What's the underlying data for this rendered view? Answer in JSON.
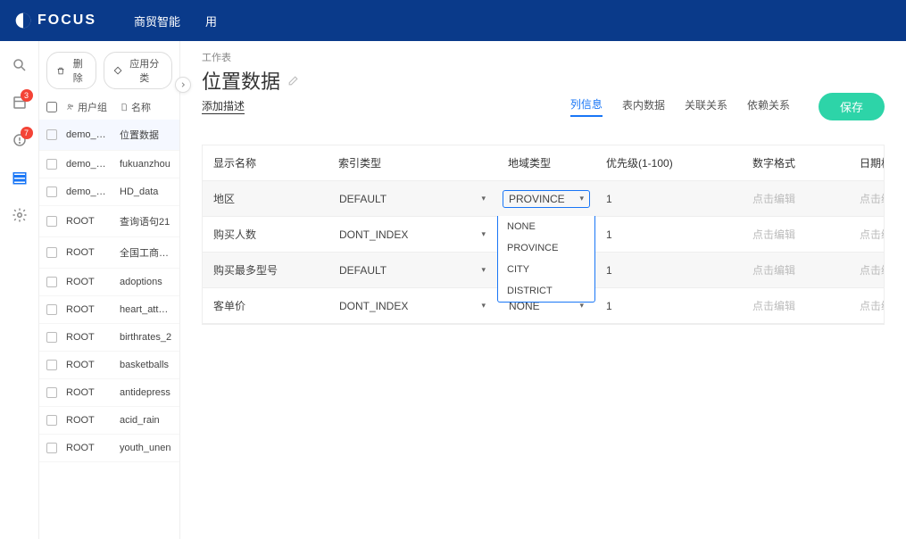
{
  "header": {
    "brand": "FOCUS",
    "nav": [
      "商贸智能",
      "用"
    ]
  },
  "rail": {
    "badges": {
      "pin": "3",
      "bell": "7"
    }
  },
  "sidebar": {
    "delete_btn": "删除",
    "category_btn": "应用分类",
    "col_usergroup": "用户组",
    "col_name": "名称",
    "rows": [
      {
        "ug": "demo_gu...",
        "nm": "位置数据",
        "active": true
      },
      {
        "ug": "demo_gu...",
        "nm": "fukuanzhou"
      },
      {
        "ug": "demo_gu...",
        "nm": "HD_data"
      },
      {
        "ug": "ROOT",
        "nm": "查询语句21"
      },
      {
        "ug": "ROOT",
        "nm": "全国工商数据"
      },
      {
        "ug": "ROOT",
        "nm": "adoptions"
      },
      {
        "ug": "ROOT",
        "nm": "heart_attack"
      },
      {
        "ug": "ROOT",
        "nm": "birthrates_2"
      },
      {
        "ug": "ROOT",
        "nm": "basketballs"
      },
      {
        "ug": "ROOT",
        "nm": "antidepress"
      },
      {
        "ug": "ROOT",
        "nm": "acid_rain"
      },
      {
        "ug": "ROOT",
        "nm": "youth_unen"
      }
    ]
  },
  "main": {
    "crumb": "工作表",
    "title": "位置数据",
    "desc_link": "添加描述",
    "tabs": [
      "列信息",
      "表内数据",
      "关联关系",
      "依赖关系"
    ],
    "active_tab": 0,
    "save": "保存"
  },
  "table": {
    "headers": {
      "name": "显示名称",
      "index": "索引类型",
      "geo": "地域类型",
      "prio": "优先级(1-100)",
      "numf": "数字格式",
      "datef": "日期格式"
    },
    "placeholder": "点击编辑",
    "rows": [
      {
        "name": "地区",
        "index": "DEFAULT",
        "geo": "PROVINCE",
        "prio": "1",
        "open": true
      },
      {
        "name": "购买人数",
        "index": "DONT_INDEX",
        "geo": "",
        "prio": "1"
      },
      {
        "name": "购买最多型号",
        "index": "DEFAULT",
        "geo": "",
        "prio": "1"
      },
      {
        "name": "客单价",
        "index": "DONT_INDEX",
        "geo": "NONE",
        "prio": "1"
      }
    ],
    "geo_options": [
      "NONE",
      "PROVINCE",
      "CITY",
      "DISTRICT"
    ]
  }
}
